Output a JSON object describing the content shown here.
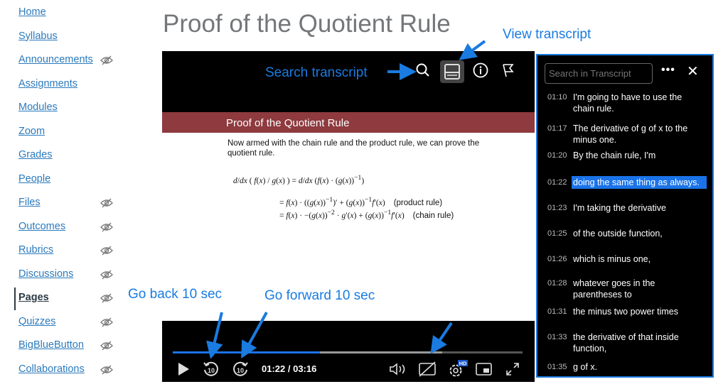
{
  "sidebar": {
    "items": [
      {
        "label": "Home",
        "hidden": false
      },
      {
        "label": "Syllabus",
        "hidden": false
      },
      {
        "label": "Announcements",
        "hidden": true
      },
      {
        "label": "Assignments",
        "hidden": false
      },
      {
        "label": "Modules",
        "hidden": false
      },
      {
        "label": "Zoom",
        "hidden": false
      },
      {
        "label": "Grades",
        "hidden": false
      },
      {
        "label": "People",
        "hidden": false
      },
      {
        "label": "Files",
        "hidden": true
      },
      {
        "label": "Outcomes",
        "hidden": true
      },
      {
        "label": "Rubrics",
        "hidden": true
      },
      {
        "label": "Discussions",
        "hidden": true
      },
      {
        "label": "Pages",
        "hidden": true,
        "active": true
      },
      {
        "label": "Quizzes",
        "hidden": true
      },
      {
        "label": "BigBlueButton",
        "hidden": true
      },
      {
        "label": "Collaborations",
        "hidden": true
      }
    ]
  },
  "page": {
    "title": "Proof of the Quotient Rule"
  },
  "slide": {
    "title": "Proof of the Quotient Rule",
    "body": "Now armed with the chain rule and the product rule, we can prove the quotient rule.",
    "note1": "(product rule)",
    "note2": "(chain rule)"
  },
  "player": {
    "current_time": "01:22",
    "duration": "03:16",
    "time_display": "01:22 / 03:16",
    "progress_percent": 42,
    "buffered_percent": 77,
    "skip_seconds": "10",
    "quality_badge": "HD",
    "accent": "#1a73e8"
  },
  "transcript": {
    "search_placeholder": "Search in Transcript",
    "more_label": "•••",
    "close_label": "✕",
    "cues": [
      {
        "time": "01:10",
        "text": "I'm going to have to use the chain rule."
      },
      {
        "time": "01:17",
        "text": "The derivative of g of x to the minus one."
      },
      {
        "time": "01:20",
        "text": "By the chain rule, I'm"
      },
      {
        "time": "01:22",
        "text": "doing the same thing as always.",
        "active": true
      },
      {
        "time": "01:23",
        "text": "I'm taking the derivative"
      },
      {
        "time": "01:25",
        "text": "of the outside function,"
      },
      {
        "time": "01:26",
        "text": "which is minus one,"
      },
      {
        "time": "01:28",
        "text": "whatever goes in the parentheses to"
      },
      {
        "time": "01:31",
        "text": "the minus two power times"
      },
      {
        "time": "01:33",
        "text": "the derivative of that inside function,"
      },
      {
        "time": "01:35",
        "text": "g of x."
      }
    ]
  },
  "annotations": {
    "search": "Search transcript",
    "view": "View transcript",
    "back": "Go back 10 sec",
    "forward": "Go forward 10 sec",
    "color": "#1a7be0"
  }
}
